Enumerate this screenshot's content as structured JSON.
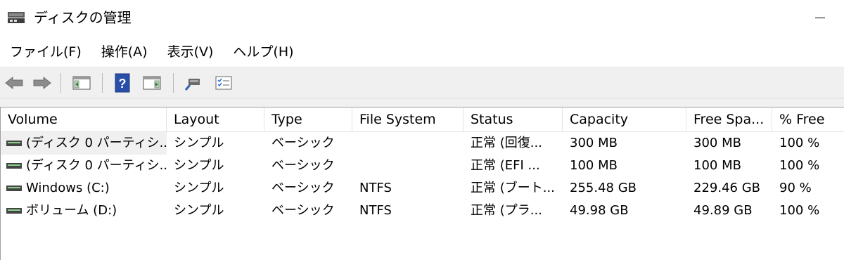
{
  "window": {
    "title": "ディスクの管理"
  },
  "menu": [
    "ファイル(F)",
    "操作(A)",
    "表示(V)",
    "ヘルプ(H)"
  ],
  "toolbar": {
    "buttons": [
      "back-icon",
      "forward-icon",
      "console-tree-icon",
      "help-icon",
      "action-pane-icon",
      "connect-icon",
      "properties-icon"
    ]
  },
  "table": {
    "columns": [
      "Volume",
      "Layout",
      "Type",
      "File System",
      "Status",
      "Capacity",
      "Free Spa...",
      "% Free"
    ],
    "rows": [
      {
        "volume": "(ディスク 0 パーティシ...",
        "layout": "シンプル",
        "type": "ベーシック",
        "fs": "",
        "status": "正常 (回復...",
        "capacity": "300 MB",
        "free": "300 MB",
        "pct": "100 %"
      },
      {
        "volume": "(ディスク 0 パーティシ...",
        "layout": "シンプル",
        "type": "ベーシック",
        "fs": "",
        "status": "正常 (EFI ...",
        "capacity": "100 MB",
        "free": "100 MB",
        "pct": "100 %"
      },
      {
        "volume": "Windows (C:)",
        "layout": "シンプル",
        "type": "ベーシック",
        "fs": "NTFS",
        "status": "正常 (ブート...",
        "capacity": "255.48 GB",
        "free": "229.46 GB",
        "pct": "90 %"
      },
      {
        "volume": "ボリューム (D:)",
        "layout": "シンプル",
        "type": "ベーシック",
        "fs": "NTFS",
        "status": "正常 (プラ...",
        "capacity": "49.98 GB",
        "free": "49.89 GB",
        "pct": "100 %"
      }
    ]
  }
}
